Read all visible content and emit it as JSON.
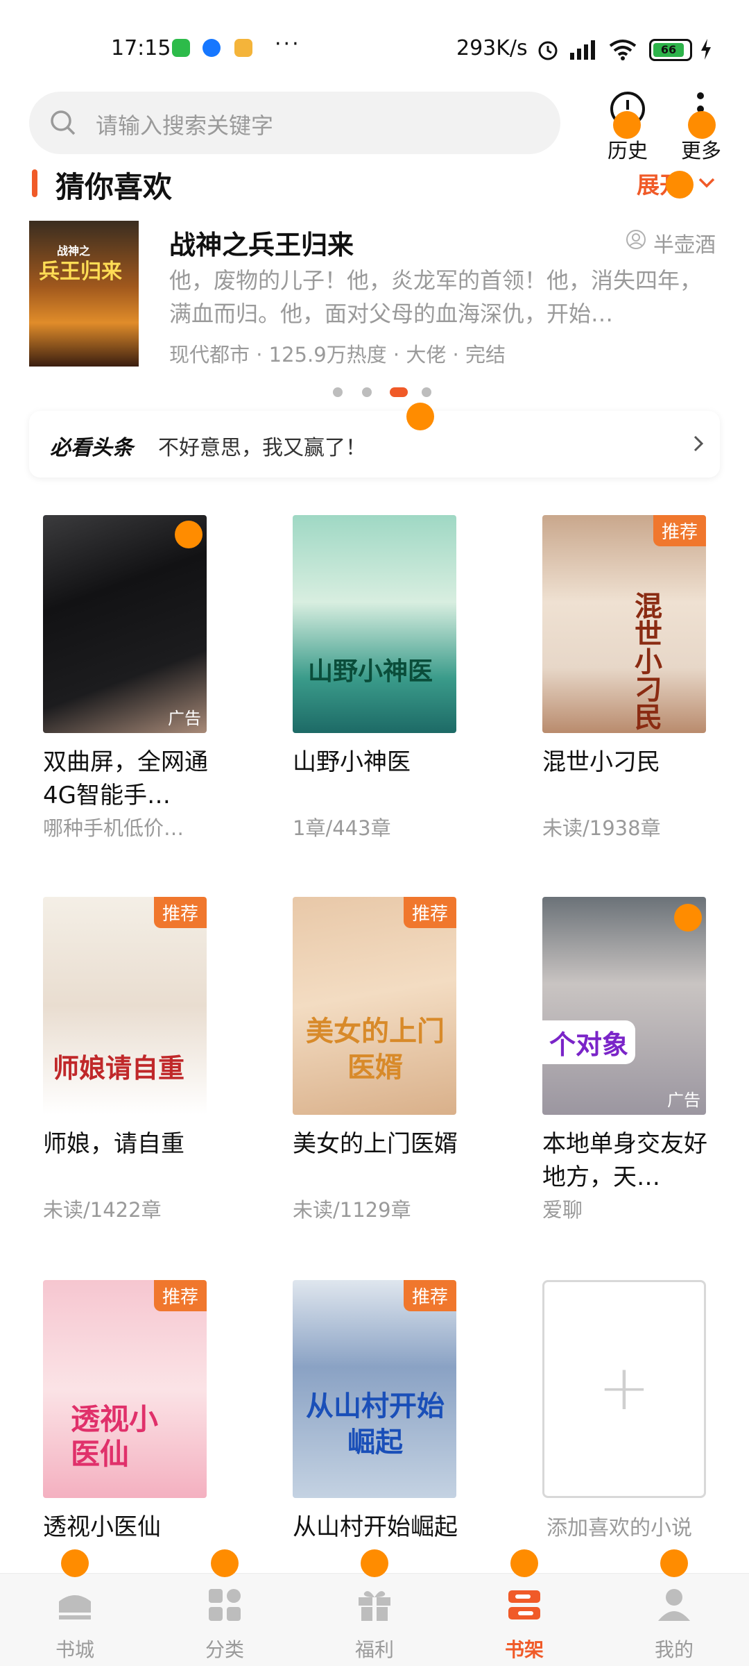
{
  "status_bar": {
    "time": "17:15",
    "dots": "···",
    "net_speed": "293K/s",
    "battery": "66",
    "icons": [
      "wechat-app-icon",
      "browser-app-icon",
      "game-app-icon",
      "alarm-icon",
      "signal-icon",
      "wifi-icon",
      "battery-icon",
      "charging-icon"
    ]
  },
  "header": {
    "search_placeholder": "请输入搜索关键字",
    "history_label": "历史",
    "more_label": "更多"
  },
  "guess": {
    "title": "猜你喜欢",
    "expand_label": "展开",
    "featured": {
      "cover_text": "兵王归来",
      "cover_small": "战神之",
      "title": "战神之兵王归来",
      "author": "半壶酒",
      "desc": "他，废物的儿子！他，炎龙军的首领！他，消失四年，满血而归。他，面对父母的血海深仇，开始…",
      "meta": "现代都市 · 125.9万热度 · 大佬 · 完结"
    },
    "carousel_active_index": 2,
    "carousel_count": 4
  },
  "headline": {
    "logo": "必看头条",
    "text": "不好意思，我又赢了！"
  },
  "books": [
    {
      "title": "双曲屏，全网通4G智能手…",
      "sub": "哪种手机低价…",
      "badge": "",
      "ad": "广告"
    },
    {
      "title": "山野小神医",
      "sub": "1章/443章",
      "badge": "",
      "ad": "",
      "cover_text": "山野小神医"
    },
    {
      "title": "混世小刁民",
      "sub": "未读/1938章",
      "badge": "推荐",
      "ad": "",
      "cover_text": "混世小刁民"
    },
    {
      "title": "师娘，请自重",
      "sub": "未读/1422章",
      "badge": "推荐",
      "ad": "",
      "cover_text": "师娘请自重"
    },
    {
      "title": "美女的上门医婿",
      "sub": "未读/1129章",
      "badge": "推荐",
      "ad": "",
      "cover_text": "美女的上门医婿"
    },
    {
      "title": "本地单身交友好地方，天…",
      "sub": "爱聊",
      "badge": "",
      "ad": "广告",
      "cover_text": "个对象"
    },
    {
      "title": "透视小医仙",
      "sub": "",
      "badge": "推荐",
      "ad": "",
      "cover_text": "透视小医仙"
    },
    {
      "title": "从山村开始崛起",
      "sub": "",
      "badge": "推荐",
      "ad": "",
      "cover_text": "从山村开始崛起"
    }
  ],
  "add_card": {
    "label": "添加喜欢的小说",
    "plus": "+"
  },
  "nav": [
    {
      "label": "书城",
      "icon": "bookstore-icon"
    },
    {
      "label": "分类",
      "icon": "category-icon"
    },
    {
      "label": "福利",
      "icon": "gift-icon"
    },
    {
      "label": "书架",
      "icon": "bookshelf-icon",
      "active": true
    },
    {
      "label": "我的",
      "icon": "profile-icon"
    }
  ],
  "colors": {
    "accent": "#f05a28",
    "badge": "#f0772d",
    "muted": "#9a9a9a"
  }
}
